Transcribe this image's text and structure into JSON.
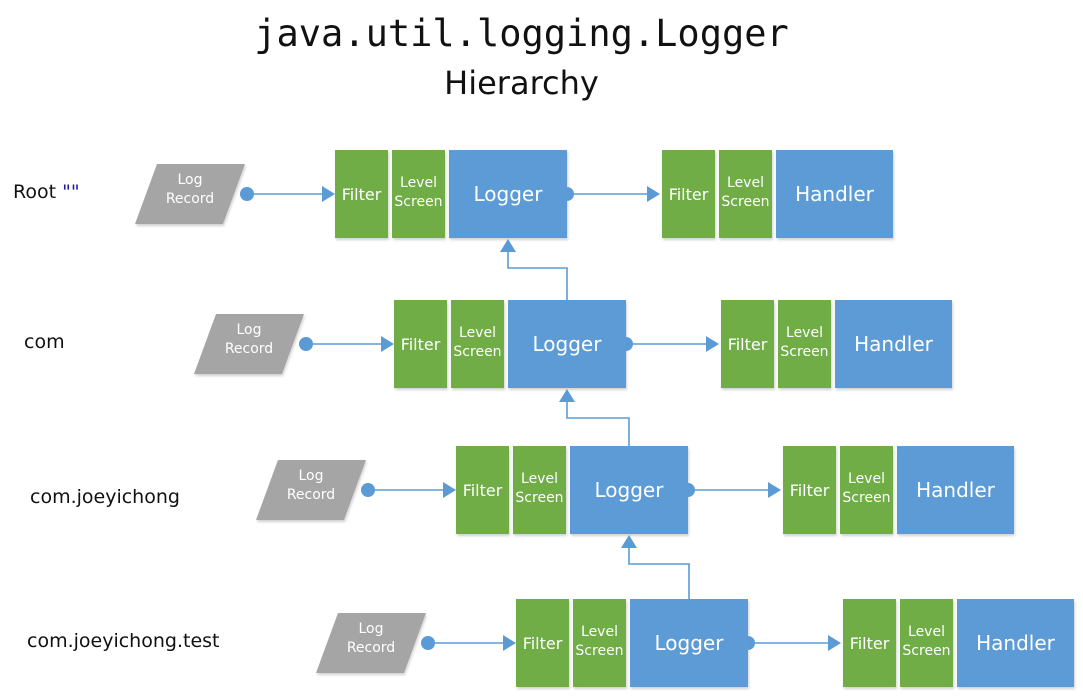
{
  "title": {
    "line1": "java.util.logging.Logger",
    "line2": "Hierarchy"
  },
  "colors": {
    "logger_blue": "#5b9bd5",
    "filter_green": "#70ad47",
    "record_gray": "#a5a5a5",
    "connector": "#5b9bd5",
    "root_quote": "#1a1aa0"
  },
  "box_labels": {
    "log_record_line1": "Log",
    "log_record_line2": "Record",
    "filter": "Filter",
    "level_line1": "Level",
    "level_line2": "Screen",
    "logger": "Logger",
    "handler": "Handler"
  },
  "rows": [
    {
      "name": "Root",
      "quote": "\"\"",
      "parent": null
    },
    {
      "name": "com",
      "quote": "",
      "parent": "Root"
    },
    {
      "name": "com.joeyichong",
      "quote": "",
      "parent": "com"
    },
    {
      "name": "com.joeyichong.test",
      "quote": "",
      "parent": "com.joeyichong"
    }
  ]
}
